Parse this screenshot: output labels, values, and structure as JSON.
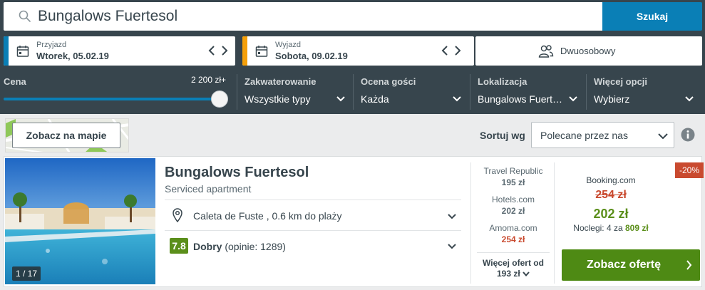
{
  "search": {
    "query": "Bungalows Fuertesol",
    "button_label": "Szukaj"
  },
  "dates": {
    "checkin": {
      "label": "Przyjazd",
      "value": "Wtorek, 05.02.19",
      "accent": "#0a7fb6"
    },
    "checkout": {
      "label": "Wyjazd",
      "value": "Sobota, 09.02.19",
      "accent": "#f5a00a"
    }
  },
  "guests": {
    "value": "Dwuosobowy"
  },
  "filters": {
    "price": {
      "label": "Cena",
      "max_value": "2 200 zł+",
      "level": 1.0
    },
    "accommodation": {
      "label": "Zakwaterowanie",
      "value": "Wszystkie typy"
    },
    "rating": {
      "label": "Ocena gości",
      "value": "Każda"
    },
    "location": {
      "label": "Lokalizacja",
      "value": "Bungalows Fuert…"
    },
    "more": {
      "label": "Więcej opcji",
      "value": "Wybierz"
    }
  },
  "map": {
    "button_label": "Zobacz na mapie"
  },
  "sort": {
    "label": "Sortuj wg",
    "value": "Polecane przez nas"
  },
  "hotel": {
    "name": "Bungalows Fuertesol",
    "type": "Serviced apartment",
    "photo_counter": "1 / 17",
    "location": "Caleta de Fuste , 0.6 km do plaży",
    "rating_score": "7.8",
    "rating_word": "Dobry",
    "rating_reviews": "(opinie: 1289)",
    "offers": [
      {
        "provider": "Travel Republic",
        "price": "195 zł"
      },
      {
        "provider": "Hotels.com",
        "price": "202 zł"
      },
      {
        "provider": "Amoma.com",
        "price": "254 zł"
      }
    ],
    "more_offers_label": "Więcej ofert od",
    "more_offers_price": "193 zł",
    "best_deal": {
      "discount": "-20%",
      "provider": "Booking.com",
      "old_price": "254 zł",
      "price": "202 zł",
      "nights_prefix": "Noclegi: 4 za",
      "nights_total": "809 zł",
      "cta_label": "Zobacz ofertę"
    }
  },
  "colors": {
    "header_bg": "#37454d",
    "primary_blue": "#0a7fb6",
    "green": "#5b8f1b",
    "red": "#c94a2f"
  }
}
